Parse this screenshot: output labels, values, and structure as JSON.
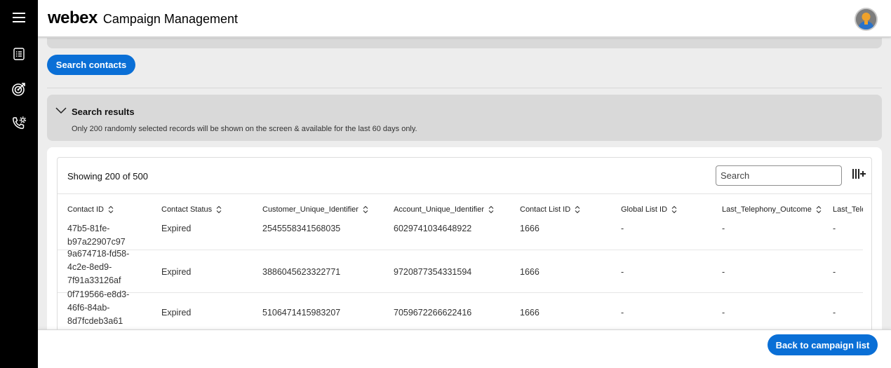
{
  "app": {
    "logo": "webex",
    "title": "Campaign Management"
  },
  "nav": {
    "menu_icon": "hamburger-menu-icon",
    "items": [
      {
        "icon": "list-document-icon"
      },
      {
        "icon": "target-icon"
      },
      {
        "icon": "phone-settings-icon"
      }
    ]
  },
  "search_contacts": {
    "label": "Search contacts"
  },
  "results": {
    "title": "Search results",
    "note": "Only 200 randomly selected records will be shown on the screen & available for the last 60 days only.",
    "showing": "Showing 200 of 500",
    "search_placeholder": "Search",
    "columns": [
      "Contact ID",
      "Contact Status",
      "Customer_Unique_Identifier",
      "Account_Unique_Identifier",
      "Contact List ID",
      "Global List ID",
      "Last_Telephony_Outcome",
      "Last_Tele"
    ],
    "rows": [
      [
        "47b5-81fe-b97a22907c97",
        "Expired",
        "2545558341568035",
        "6029741034648922",
        "1666",
        "-",
        "-",
        "-"
      ],
      [
        "9a674718-fd58-4c2e-8ed9-7f91a33126af",
        "Expired",
        "3886045623322771",
        "9720877354331594",
        "1666",
        "-",
        "-",
        "-"
      ],
      [
        "0f719566-e8d3-46f6-84ab-8d7fcdeb3a61",
        "Expired",
        "5106471415983207",
        "7059672266622416",
        "1666",
        "-",
        "-",
        "-"
      ]
    ]
  },
  "footer": {
    "back_label": "Back to campaign list"
  },
  "colors": {
    "primary": "#0a6fd6",
    "rail": "#000000",
    "panel": "#d9d9d9",
    "page_bg": "#ededed"
  }
}
